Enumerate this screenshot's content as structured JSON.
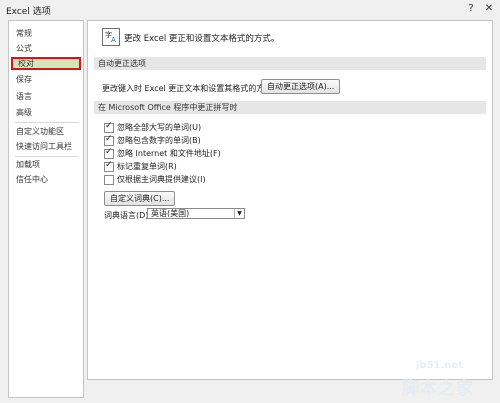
{
  "window": {
    "title": "Excel 选项",
    "help_glyph": "?",
    "close_glyph": "✕"
  },
  "sidebar": {
    "items": [
      {
        "label": "常规"
      },
      {
        "label": "公式"
      },
      {
        "label": "校对",
        "selected": true
      },
      {
        "label": "保存"
      },
      {
        "label": "语言"
      },
      {
        "label": "高级"
      },
      {
        "label": "自定义功能区"
      },
      {
        "label": "快速访问工具栏"
      },
      {
        "label": "加载项"
      },
      {
        "label": "信任中心"
      }
    ]
  },
  "main": {
    "header": {
      "icon": "proofing-abc-icon",
      "icon_text_a": "字",
      "icon_text_b": "A",
      "text": "更改 Excel 更正和设置文本格式的方式。"
    },
    "autocorrect": {
      "section_title": "自动更正选项",
      "label": "更改键入时 Excel 更正文本和设置其格式的方式:",
      "button_label": "自动更正选项(A)..."
    },
    "spelling": {
      "section_title": "在 Microsoft Office 程序中更正拼写时",
      "options": [
        {
          "label": "忽略全部大写的单词(U)",
          "checked": true
        },
        {
          "label": "忽略包含数字的单词(B)",
          "checked": true
        },
        {
          "label": "忽略 Internet 和文件地址(F)",
          "checked": true
        },
        {
          "label": "标记重复单词(R)",
          "checked": true
        },
        {
          "label": "仅根据主词典提供建议(I)",
          "checked": false
        }
      ],
      "custom_dict_button": "自定义词典(C)...",
      "dict_lang_label": "词典语言(D):",
      "dict_lang_value": "英语(美国)"
    }
  },
  "watermark": {
    "url": "jb51.net",
    "text": "脚本之家"
  }
}
